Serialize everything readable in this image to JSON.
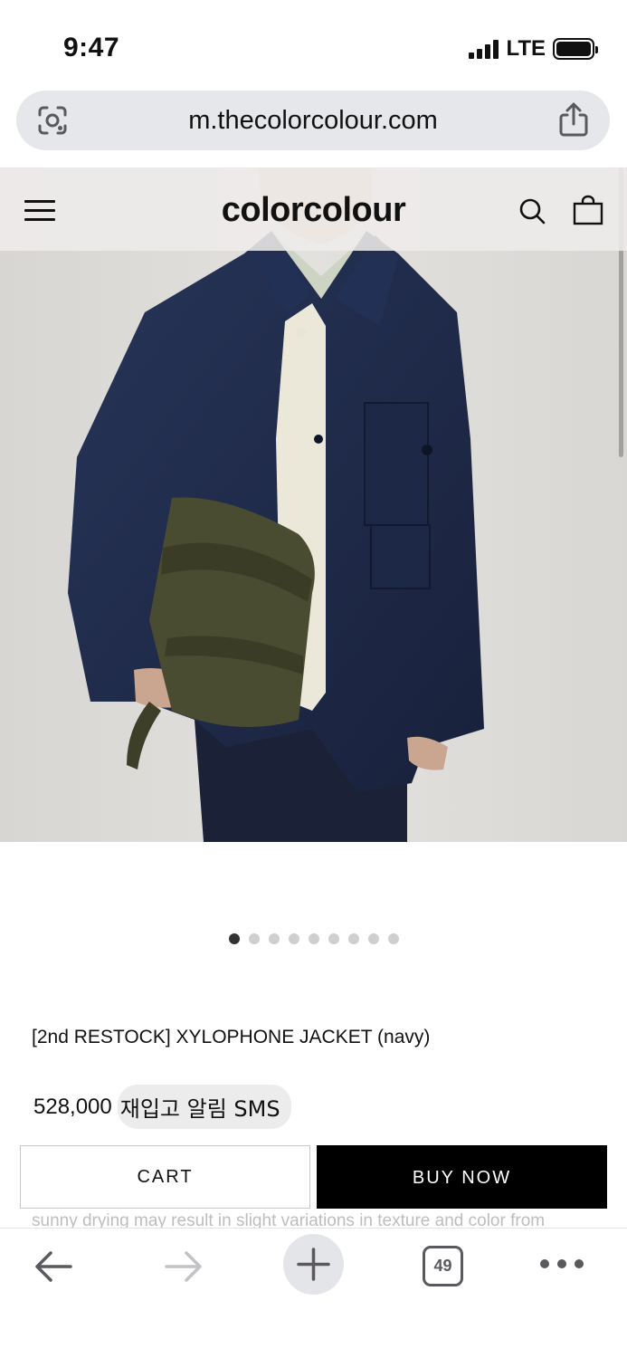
{
  "status_bar": {
    "time": "9:47",
    "network": "LTE"
  },
  "browser": {
    "url": "m.thecolorcolour.com",
    "tab_count": "49"
  },
  "site": {
    "brand": "colorcolour"
  },
  "carousel": {
    "dot_count": 9,
    "active_index": 0
  },
  "product": {
    "title": "[2nd RESTOCK] XYLOPHONE JACKET (navy)",
    "price": "528,000",
    "restock_sms": "재입고 알림 SMS",
    "description_partial": "sunny drying may result in slight variations in texture and color from"
  },
  "buttons": {
    "cart": "CART",
    "buy_now": "BUY NOW"
  },
  "colors": {
    "accent": "#000000",
    "jacket": "#1f2b49",
    "bag": "#4a4c31"
  }
}
